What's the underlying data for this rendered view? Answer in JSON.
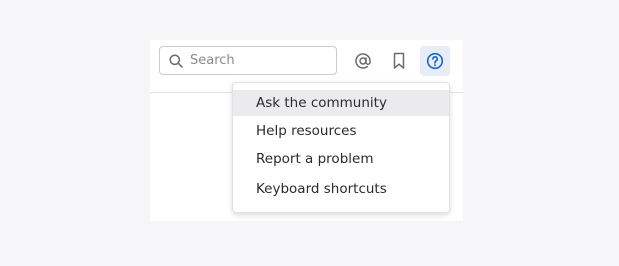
{
  "toolbar": {
    "search_placeholder": "Search",
    "search_value": "",
    "icons": {
      "search": "search-icon",
      "mention": "at-sign-icon",
      "bookmark": "bookmark-icon",
      "help": "help-circle-icon"
    },
    "accent_color": "#1d64c9",
    "icon_color": "#6b6b73"
  },
  "help_menu": {
    "items": [
      {
        "label": "Ask the community",
        "highlighted": true
      },
      {
        "label": "Help resources",
        "highlighted": false
      },
      {
        "label": "Report a problem",
        "highlighted": false
      },
      {
        "label": "Keyboard shortcuts",
        "highlighted": false
      }
    ]
  }
}
